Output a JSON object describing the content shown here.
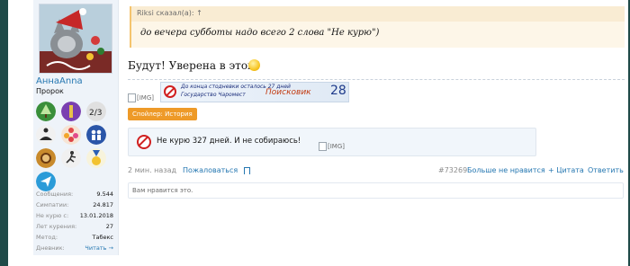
{
  "user": {
    "name": "АннаAnna",
    "title": "Пророк",
    "avatar_alt": "cat-avatar",
    "badges": [
      {
        "icon": "tree-badge-icon",
        "color": "#3a8f3a"
      },
      {
        "icon": "smoker-badge-icon",
        "color": "#7a3fb0"
      },
      {
        "icon": "calendar-badge-icon",
        "color": "#e0e0e0"
      },
      {
        "icon": "meditation-badge-icon",
        "color": "#f1f1f1"
      },
      {
        "icon": "flower-badge-icon",
        "color": "#f6e4d4"
      },
      {
        "icon": "people-badge-icon",
        "color": "#2a55a8"
      },
      {
        "icon": "lion-badge-icon",
        "color": "#c88a2c"
      },
      {
        "icon": "running-badge-icon",
        "color": "#f0f0f0"
      },
      {
        "icon": "medal-badge-icon",
        "color": "#f2d86a"
      },
      {
        "icon": "plane-badge-icon",
        "color": "#2b9bd8"
      }
    ],
    "stats": [
      {
        "label": "Сообщения:",
        "value": "9.544",
        "link": false
      },
      {
        "label": "Симпатии:",
        "value": "24.817",
        "link": false
      },
      {
        "label": "Не курю с:",
        "value": "13.01.2018",
        "link": false
      },
      {
        "label": "Лет курения:",
        "value": "27",
        "link": false
      },
      {
        "label": "Метод:",
        "value": "Табекс",
        "link": false
      },
      {
        "label": "Дневник:",
        "value": "Читать →",
        "link": true
      }
    ]
  },
  "quote": {
    "author": "Riksi сказал(а): ↑",
    "text": "до вечера субботы надо всего 2 слова \"Не курю\")"
  },
  "message": {
    "text": "Будут! Уверена в этом!",
    "img_placeholder": "[IMG]",
    "banner": {
      "line1": "До конца стодневки осталось 27 дней",
      "line2": "Государство Чаромест",
      "search": "Поисковик",
      "number": "28"
    },
    "spoiler_label": "Спойлер: История",
    "signature": {
      "text": "Не курю 327 дней. И не собираюсь!",
      "img_placeholder": "[IMG]"
    }
  },
  "footer": {
    "time": "2 мин. назад",
    "report": "Пожаловаться",
    "post_id": "#73269",
    "unlike": "Больше не нравится",
    "quote": "+ Цитата",
    "reply": "Ответить"
  },
  "reactions": {
    "text": "Вам нравится это."
  },
  "colors": {
    "background": "#1f4a48",
    "link": "#2577b1",
    "quote_bg": "#fdf6e8",
    "spoiler": "#ee9a28"
  }
}
